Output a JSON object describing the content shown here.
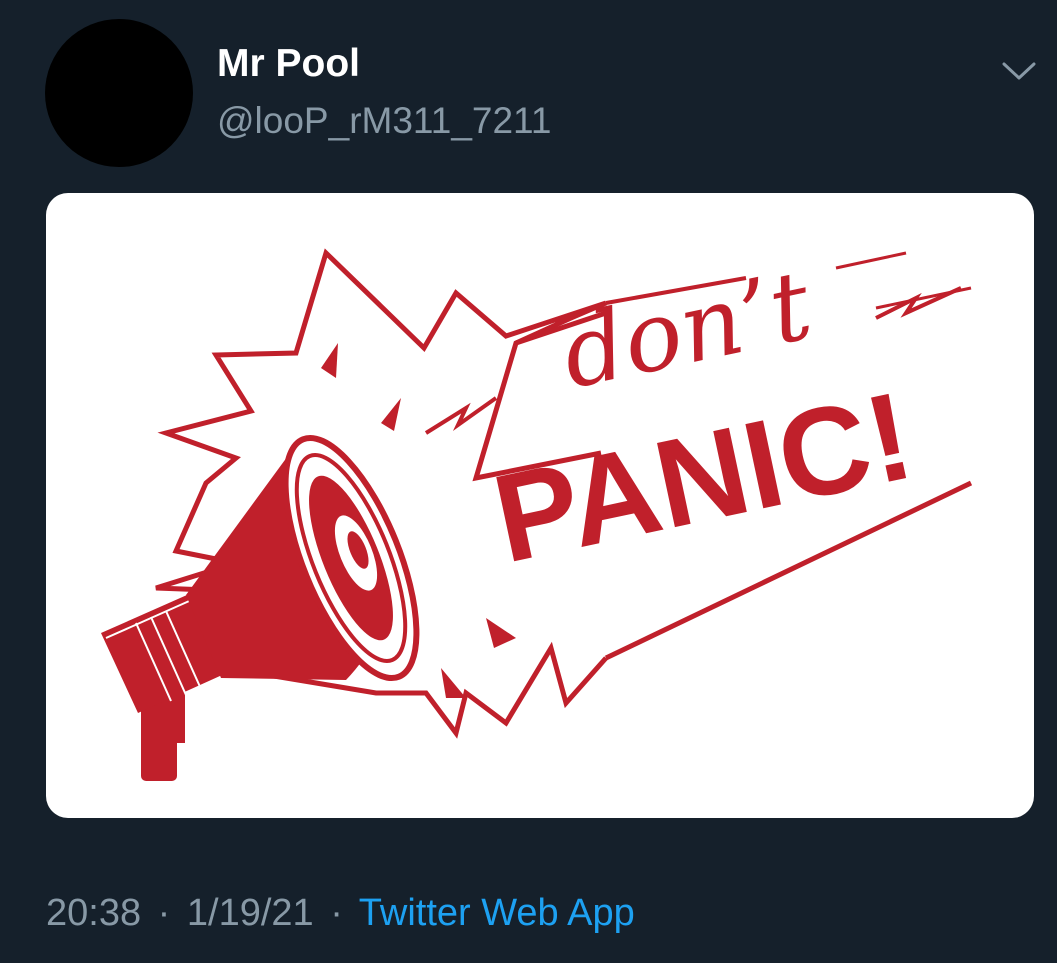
{
  "tweet": {
    "display_name": "Mr Pool",
    "handle": "@looP_rM311_7211",
    "time": "20:38",
    "date": "1/19/21",
    "separator": "·",
    "source": "Twitter Web App",
    "menu_icon": "chevron-down-icon"
  },
  "image": {
    "line1": "don’t",
    "line2": "PANIC!",
    "accent_color": "#c0202b",
    "background_color": "#ffffff"
  },
  "colors": {
    "background": "#15202b",
    "name": "#ffffff",
    "secondary_text": "#8899a6",
    "link": "#1da1f2"
  }
}
